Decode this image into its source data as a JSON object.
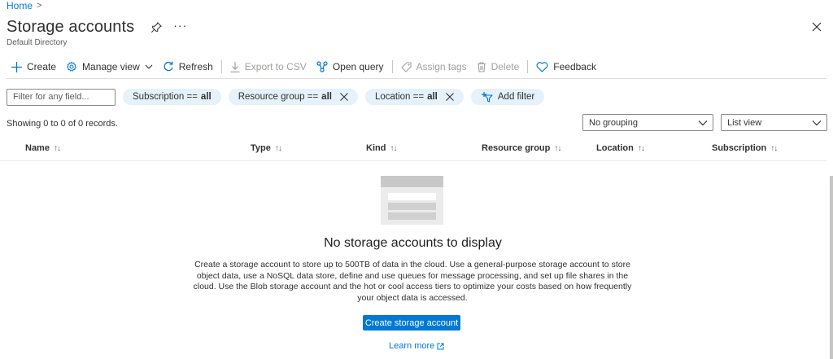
{
  "breadcrumb": {
    "home": "Home",
    "separator": ">"
  },
  "header": {
    "title": "Storage accounts",
    "subtitle": "Default Directory",
    "more": "···"
  },
  "toolbar": {
    "create": "Create",
    "manage_view": "Manage view",
    "refresh": "Refresh",
    "export_csv": "Export to CSV",
    "open_query": "Open query",
    "assign_tags": "Assign tags",
    "delete": "Delete",
    "feedback": "Feedback"
  },
  "filters": {
    "search_placeholder": "Filter for any field...",
    "subscription": {
      "label": "Subscription ==",
      "value": "all"
    },
    "resource_group": {
      "label": "Resource group ==",
      "value": "all"
    },
    "location": {
      "label": "Location ==",
      "value": "all"
    },
    "add_filter": "Add filter"
  },
  "records_text": "Showing 0 to 0 of 0 records.",
  "grouping": {
    "selected": "No grouping"
  },
  "view": {
    "selected": "List view"
  },
  "columns": [
    {
      "label": "Name"
    },
    {
      "label": "Type"
    },
    {
      "label": "Kind"
    },
    {
      "label": "Resource group"
    },
    {
      "label": "Location"
    },
    {
      "label": "Subscription"
    }
  ],
  "empty_state": {
    "title": "No storage accounts to display",
    "description": "Create a storage account to store up to 500TB of data in the cloud. Use a general-purpose storage account to store object data, use a NoSQL data store, define and use queues for message processing, and set up file shares in the cloud. Use the Blob storage account and the hot or cool access tiers to optimize your costs based on how frequently your object data is accessed.",
    "create_button": "Create storage account",
    "learn_more": "Learn more"
  },
  "colors": {
    "accent": "#0078d4",
    "pill_bg": "#e5f1fb",
    "text": "#323130"
  }
}
